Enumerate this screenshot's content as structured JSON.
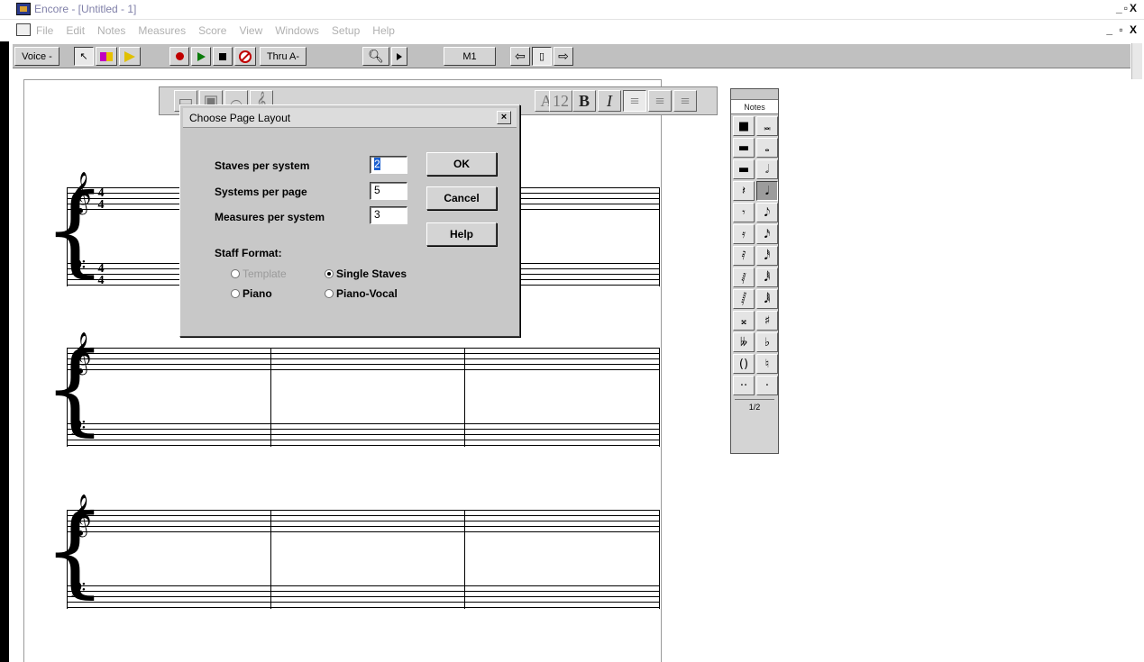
{
  "window": {
    "title": "Encore - [Untitled - 1]",
    "controls": "_ \u0018 X"
  },
  "menu": [
    "File",
    "Edit",
    "Notes",
    "Measures",
    "Score",
    "View",
    "Windows",
    "Setup",
    "Help"
  ],
  "toolbar": {
    "voice": "Voice -",
    "thru": "Thru A-",
    "measure": "M1"
  },
  "notes_palette": {
    "title": "Notes",
    "page": "1/2",
    "cells": [
      "■",
      "𝅜",
      "▬",
      "𝅝",
      "▬",
      "𝅗𝅥",
      "𝄽",
      "𝅘𝅥",
      "𝄾",
      "𝅘𝅥𝅮",
      "𝄿",
      "𝅘𝅥𝅯",
      "𝅀",
      "𝅘𝅥𝅰",
      "𝅁",
      "𝅘𝅥𝅱",
      "𝅂",
      "𝅘𝅥𝅲",
      "𝄪",
      "♯",
      "𝄫",
      "♭",
      "()",
      "♮",
      "··",
      "·"
    ]
  },
  "dialog": {
    "title": "Choose Page Layout",
    "close": "×",
    "fields": [
      {
        "label": "Staves per system",
        "value": "2"
      },
      {
        "label": "Systems per page",
        "value": "5"
      },
      {
        "label": "Measures per system",
        "value": "3"
      }
    ],
    "buttons": {
      "ok": "OK",
      "cancel": "Cancel",
      "help": "Help"
    },
    "staff_format": {
      "label": "Staff Format:",
      "options": [
        {
          "label": "Template",
          "selected": false,
          "disabled": true
        },
        {
          "label": "Single Staves",
          "selected": true,
          "disabled": false
        },
        {
          "label": "Piano",
          "selected": false,
          "disabled": false
        },
        {
          "label": "Piano-Vocal",
          "selected": false,
          "disabled": false
        }
      ]
    }
  },
  "score": {
    "time_signature": {
      "top": "4",
      "bottom": "4"
    }
  }
}
